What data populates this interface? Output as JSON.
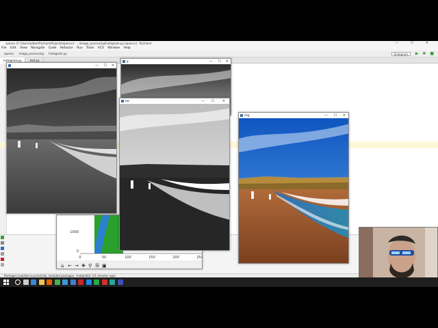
{
  "ide": {
    "title": "opencv [C:\\Users\\wiktor\\PycharmProjects\\opencv] - ...\\image_processing\\histogram.py [opencv] - PyCharm",
    "menu": [
      "File",
      "Edit",
      "View",
      "Navigate",
      "Code",
      "Refactor",
      "Run",
      "Tools",
      "VCS",
      "Window",
      "Help"
    ],
    "breadcrumb": [
      "opencv",
      "image_processing",
      "histogram.py"
    ],
    "run_config": "histogram",
    "tabs": [
      "histogram.py",
      "test.py"
    ],
    "status": "Packages installed successfully: Installed packages: 'matplotlib' (11 minutes ago)"
  },
  "windows": {
    "gray_large": {
      "title": ""
    },
    "gray_small": {
      "title": "g"
    },
    "bw": {
      "title": "bw"
    },
    "color": {
      "title": "img"
    }
  },
  "histogram": {
    "toolbar_icons": [
      "home-icon",
      "back-icon",
      "forward-icon",
      "pan-icon",
      "zoom-icon",
      "configure-icon",
      "save-icon"
    ]
  },
  "chart_data": {
    "type": "bar",
    "x": [
      0,
      50,
      100,
      150,
      200,
      250
    ],
    "x_ticks": [
      "0",
      "50",
      "100",
      "150",
      "200",
      "250"
    ],
    "y_ticks": [
      "1000",
      "0"
    ],
    "series": [
      {
        "color": "#2c7fd0"
      },
      {
        "color": "#2ca02c"
      }
    ]
  },
  "taskbar": {
    "icons": [
      {
        "name": "search-icon",
        "color": "#ffffff"
      },
      {
        "name": "task-view-icon",
        "color": "#cccccc"
      },
      {
        "name": "edge-icon",
        "color": "#3b8ad8"
      },
      {
        "name": "explorer-icon",
        "color": "#f2c14e"
      },
      {
        "name": "firefox-icon",
        "color": "#e66000"
      },
      {
        "name": "chrome-icon",
        "color": "#4caf50"
      },
      {
        "name": "vscode-icon",
        "color": "#3c99dc"
      },
      {
        "name": "paint-icon",
        "color": "#3f7fd6"
      },
      {
        "name": "news-icon",
        "color": "#c62828"
      },
      {
        "name": "photos-icon",
        "color": "#1e88e5"
      },
      {
        "name": "pycharm-icon",
        "color": "#2aa84a"
      },
      {
        "name": "opera-icon",
        "color": "#d32f2f"
      },
      {
        "name": "app-icon",
        "color": "#26a69a"
      },
      {
        "name": "python-icon",
        "color": "#3f51b5"
      }
    ]
  }
}
